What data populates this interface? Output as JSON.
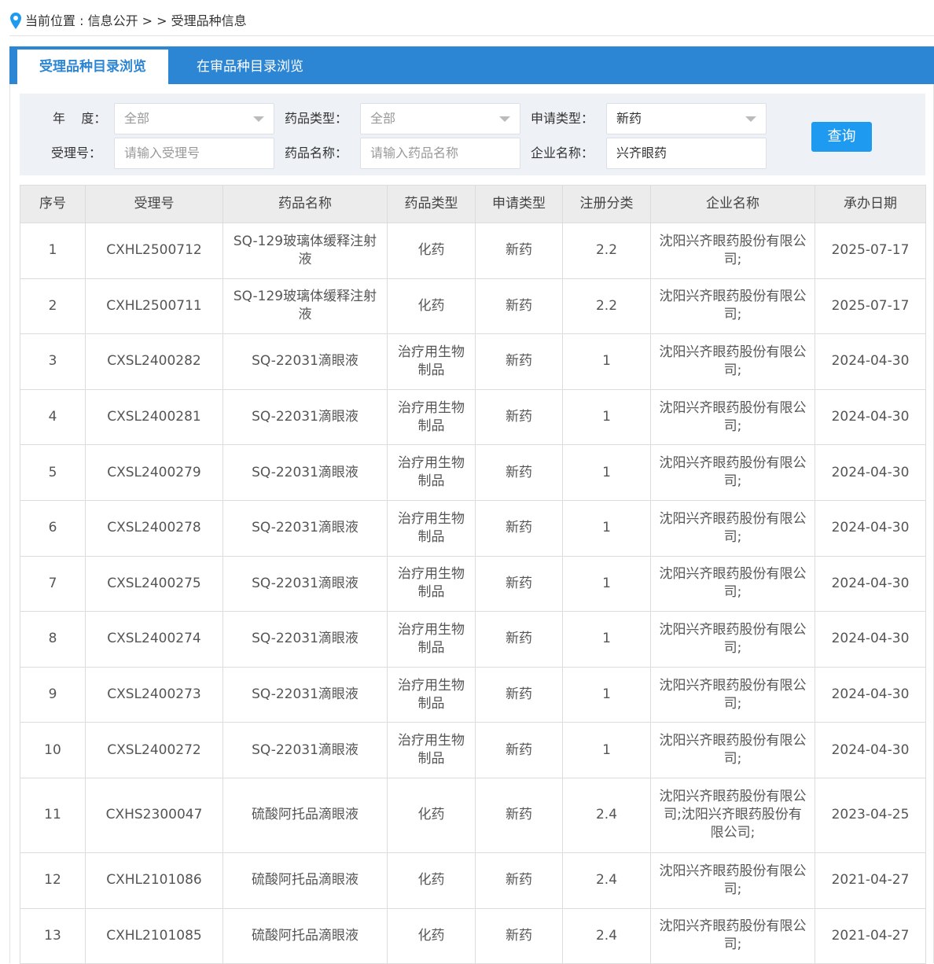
{
  "breadcrumb": {
    "prefix": "当前位置 : ",
    "section": "信息公开",
    "separator": " > > ",
    "current": "受理品种信息"
  },
  "tabs": [
    {
      "label": "受理品种目录浏览",
      "active": true
    },
    {
      "label": "在审品种目录浏览",
      "active": false
    }
  ],
  "filters": {
    "year": {
      "label": "年    度：",
      "value": "全部"
    },
    "drug_type": {
      "label": "药品类型：",
      "value": "全部"
    },
    "apply_type": {
      "label": "申请类型：",
      "value": "新药"
    },
    "accept_no": {
      "label": "受理号：",
      "placeholder": "请输入受理号",
      "value": ""
    },
    "drug_name": {
      "label": "药品名称：",
      "placeholder": "请输入药品名称",
      "value": ""
    },
    "company": {
      "label": "企业名称：",
      "value": "兴齐眼药"
    },
    "query_button": "查询"
  },
  "table": {
    "headers": [
      "序号",
      "受理号",
      "药品名称",
      "药品类型",
      "申请类型",
      "注册分类",
      "企业名称",
      "承办日期"
    ],
    "rows": [
      [
        "1",
        "CXHL2500712",
        "SQ-129玻璃体缓释注射液",
        "化药",
        "新药",
        "2.2",
        "沈阳兴齐眼药股份有限公司;",
        "2025-07-17"
      ],
      [
        "2",
        "CXHL2500711",
        "SQ-129玻璃体缓释注射液",
        "化药",
        "新药",
        "2.2",
        "沈阳兴齐眼药股份有限公司;",
        "2025-07-17"
      ],
      [
        "3",
        "CXSL2400282",
        "SQ-22031滴眼液",
        "治疗用生物制品",
        "新药",
        "1",
        "沈阳兴齐眼药股份有限公司;",
        "2024-04-30"
      ],
      [
        "4",
        "CXSL2400281",
        "SQ-22031滴眼液",
        "治疗用生物制品",
        "新药",
        "1",
        "沈阳兴齐眼药股份有限公司;",
        "2024-04-30"
      ],
      [
        "5",
        "CXSL2400279",
        "SQ-22031滴眼液",
        "治疗用生物制品",
        "新药",
        "1",
        "沈阳兴齐眼药股份有限公司;",
        "2024-04-30"
      ],
      [
        "6",
        "CXSL2400278",
        "SQ-22031滴眼液",
        "治疗用生物制品",
        "新药",
        "1",
        "沈阳兴齐眼药股份有限公司;",
        "2024-04-30"
      ],
      [
        "7",
        "CXSL2400275",
        "SQ-22031滴眼液",
        "治疗用生物制品",
        "新药",
        "1",
        "沈阳兴齐眼药股份有限公司;",
        "2024-04-30"
      ],
      [
        "8",
        "CXSL2400274",
        "SQ-22031滴眼液",
        "治疗用生物制品",
        "新药",
        "1",
        "沈阳兴齐眼药股份有限公司;",
        "2024-04-30"
      ],
      [
        "9",
        "CXSL2400273",
        "SQ-22031滴眼液",
        "治疗用生物制品",
        "新药",
        "1",
        "沈阳兴齐眼药股份有限公司;",
        "2024-04-30"
      ],
      [
        "10",
        "CXSL2400272",
        "SQ-22031滴眼液",
        "治疗用生物制品",
        "新药",
        "1",
        "沈阳兴齐眼药股份有限公司;",
        "2024-04-30"
      ],
      [
        "11",
        "CXHS2300047",
        "硫酸阿托品滴眼液",
        "化药",
        "新药",
        "2.4",
        "沈阳兴齐眼药股份有限公司;沈阳兴齐眼药股份有限公司;",
        "2023-04-25"
      ],
      [
        "12",
        "CXHL2101086",
        "硫酸阿托品滴眼液",
        "化药",
        "新药",
        "2.4",
        "沈阳兴齐眼药股份有限公司;",
        "2021-04-27"
      ],
      [
        "13",
        "CXHL2101085",
        "硫酸阿托品滴眼液",
        "化药",
        "新药",
        "2.4",
        "沈阳兴齐眼药股份有限公司;",
        "2021-04-27"
      ]
    ]
  },
  "colors": {
    "accent": "#2d86d3",
    "button": "#1e9af0",
    "pin": "#1e9af0"
  }
}
